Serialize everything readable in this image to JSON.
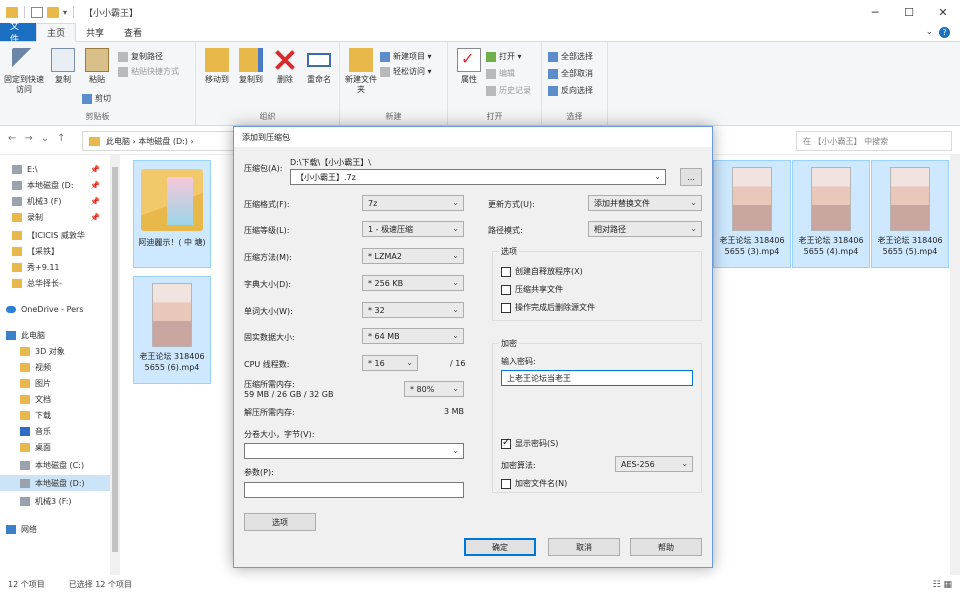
{
  "window": {
    "title": "【小小霸王】"
  },
  "ribbon_tabs": [
    "文件",
    "主页",
    "共享",
    "查看"
  ],
  "ribbon": {
    "clipboard": {
      "pin_label": "固定到快速访问",
      "copy": "复制",
      "paste": "粘贴",
      "copy_path": "复制路径",
      "paste_shortcut": "粘贴快捷方式",
      "cut": "剪切",
      "group": "剪贴板"
    },
    "organize": {
      "move_to": "移动到",
      "copy_to": "复制到",
      "delete": "删除",
      "rename": "重命名",
      "group": "组织"
    },
    "new": {
      "new_folder": "新建文件夹",
      "new_item": "新建项目 ▾",
      "easy_access": "轻松访问 ▾",
      "group": "新建"
    },
    "open": {
      "properties": "属性",
      "open": "打开 ▾",
      "edit": "编辑",
      "history": "历史记录",
      "group": "打开"
    },
    "select": {
      "select_all": "全部选择",
      "select_none": "全部取消",
      "invert": "反向选择",
      "group": "选择"
    }
  },
  "address": {
    "path": "此电脑 › 本地磁盘 (D:) ›",
    "search_placeholder": "在 【小小霸王】 中搜索"
  },
  "sidebar": {
    "items": [
      {
        "label": "E:\\",
        "icon": "drive-icon",
        "pinned": "📌"
      },
      {
        "label": "本地磁盘 (D:",
        "icon": "drive-icon",
        "pinned": "📌"
      },
      {
        "label": "机械3 (F)",
        "icon": "drive-icon",
        "pinned": "📌"
      },
      {
        "label": "录制",
        "icon": "folder-icon",
        "pinned": "📌"
      },
      {
        "label": "【ICICIS 威敦华",
        "icon": "folder-icon",
        "pinned": ""
      },
      {
        "label": "【采铁】",
        "icon": "folder-icon",
        "pinned": ""
      },
      {
        "label": "秀+9.11",
        "icon": "folder-icon",
        "pinned": ""
      },
      {
        "label": "总华择长-",
        "icon": "folder-icon",
        "pinned": ""
      },
      {
        "label": "OneDrive - Pers",
        "icon": "cloud-icon",
        "pinned": ""
      },
      {
        "label": "此电脑",
        "icon": "pc-icon",
        "pinned": ""
      },
      {
        "label": "3D 对象",
        "icon": "folder-icon",
        "pinned": ""
      },
      {
        "label": "视频",
        "icon": "folder-icon",
        "pinned": ""
      },
      {
        "label": "图片",
        "icon": "folder-icon",
        "pinned": ""
      },
      {
        "label": "文档",
        "icon": "folder-icon",
        "pinned": ""
      },
      {
        "label": "下载",
        "icon": "folder-icon",
        "pinned": ""
      },
      {
        "label": "音乐",
        "icon": "music-icon",
        "pinned": ""
      },
      {
        "label": "桌面",
        "icon": "folder-icon",
        "pinned": ""
      },
      {
        "label": "本地磁盘 (C:)",
        "icon": "drive-icon",
        "pinned": ""
      },
      {
        "label": "本地磁盘 (D:)",
        "icon": "drive-icon",
        "pinned": ""
      },
      {
        "label": "机械3 (F:)",
        "icon": "drive-icon",
        "pinned": ""
      },
      {
        "label": "网络",
        "icon": "network-icon",
        "pinned": ""
      }
    ]
  },
  "files": [
    {
      "name": "阿迪麗示！( 中 塘)",
      "kind": "folder"
    },
    {
      "name": "老王论坛 3184065655 (3).mp4",
      "kind": "video"
    },
    {
      "name": "老王论坛 3184065655 (4).mp4",
      "kind": "video"
    },
    {
      "name": "老王论坛 3184065655 (5).mp4",
      "kind": "video"
    },
    {
      "name": "老王论坛 3184065655 (6).mp4",
      "kind": "video"
    }
  ],
  "status": {
    "count": "12 个项目",
    "selected": "已选择 12 个项目"
  },
  "dialog": {
    "title": "添加到压缩包",
    "archive_label": "压缩包(A):",
    "archive_dir": "D:\\下载\\【小小霸王】\\",
    "archive_name": "【小小霸王】.7z",
    "browse": "...",
    "format_label": "压缩格式(F):",
    "format_value": "7z",
    "level_label": "压缩等级(L):",
    "level_value": "1 - 极速压缩",
    "method_label": "压缩方法(M):",
    "method_value": "* LZMA2",
    "dict_label": "字典大小(D):",
    "dict_value": "* 256 KB",
    "word_label": "单词大小(W):",
    "word_value": "* 32",
    "solid_label": "固实数据大小:",
    "solid_value": "* 64 MB",
    "cpu_label": "CPU 线程数:",
    "cpu_value": "* 16",
    "cpu_max": "/ 16",
    "mem_label": "压缩所需内存:",
    "mem_detail": "59 MB / 26 GB / 32 GB",
    "mem_value": "* 80%",
    "decomp_label": "解压所需内存:",
    "decomp_value": "3 MB",
    "split_label": "分卷大小，字节(V):",
    "split_value": "",
    "params_label": "参数(P):",
    "params_value": "",
    "options_btn": "选项",
    "update_label": "更新方式(U):",
    "update_value": "添加并替换文件",
    "path_label": "路径模式:",
    "path_value": "相对路径",
    "options_group": "选项",
    "opt_sfx": "创建自释放程序(X)",
    "opt_shared": "压缩共享文件",
    "opt_delete": "操作完成后删除源文件",
    "enc_group": "加密",
    "pwd_label": "输入密码:",
    "pwd_value": "上老王论坛当老王",
    "show_pwd": "显示密码(S)",
    "enc_method_label": "加密算法:",
    "enc_method_value": "AES-256",
    "enc_names": "加密文件名(N)",
    "ok": "确定",
    "cancel": "取消",
    "help": "帮助"
  }
}
